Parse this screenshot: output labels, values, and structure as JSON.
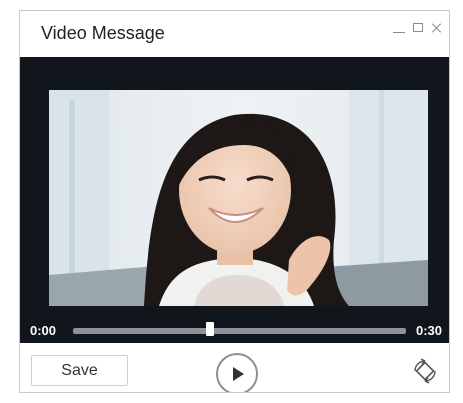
{
  "window": {
    "title": "Video Message"
  },
  "player": {
    "current_time": "0:00",
    "duration": "0:30",
    "progress": 0.41
  },
  "footer": {
    "save_label": "Save"
  },
  "icons": {
    "minimize": "minimize-icon",
    "maximize": "maximize-icon",
    "close": "close-icon",
    "play": "play-icon",
    "rotate": "rotate-icon"
  },
  "colors": {
    "player_background": "#11151c",
    "track": "#8e9298",
    "handle": "#ffffff"
  }
}
